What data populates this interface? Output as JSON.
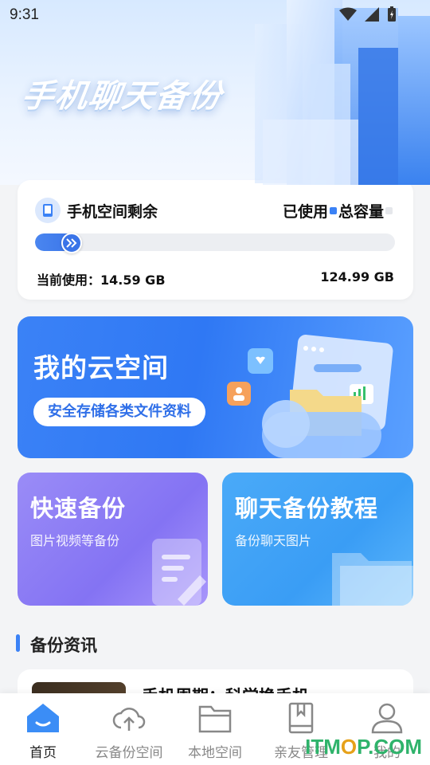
{
  "status_bar": {
    "time": "9:31"
  },
  "hero": {
    "title": "手机聊天备份"
  },
  "storage": {
    "title": "手机空间剩余",
    "legend_used": "已使用",
    "legend_total": "总容量",
    "current_use_label": "当前使用：14.59 GB",
    "total_capacity": "124.99 GB",
    "used_fraction": 0.117,
    "colors": {
      "used": "#3b82f6",
      "total": "#e5e7eb"
    }
  },
  "cloud_banner": {
    "title": "我的云空间",
    "button_label": "安全存储各类文件资料"
  },
  "features": [
    {
      "title": "快速备份",
      "subtitle": "图片视频等备份",
      "icon": "document-edit-icon"
    },
    {
      "title": "聊天备份教程",
      "subtitle": "备份聊天图片",
      "icon": "folder-icon"
    }
  ],
  "news": {
    "section_title": "备份资讯",
    "items": [
      {
        "headline": "手机周期：科学换手机"
      }
    ]
  },
  "bottom_nav": [
    {
      "label": "首页",
      "icon": "home-icon",
      "active": true
    },
    {
      "label": "云备份空间",
      "icon": "cloud-upload-icon",
      "active": false
    },
    {
      "label": "本地空间",
      "icon": "folder-icon",
      "active": false
    },
    {
      "label": "亲友管理",
      "icon": "book-icon",
      "active": false
    },
    {
      "label": "我的",
      "icon": "user-icon",
      "active": false
    }
  ],
  "watermark": {
    "text_a": "IT",
    "text_b": "M",
    "text_c": "O",
    "text_d": "P.COM"
  }
}
